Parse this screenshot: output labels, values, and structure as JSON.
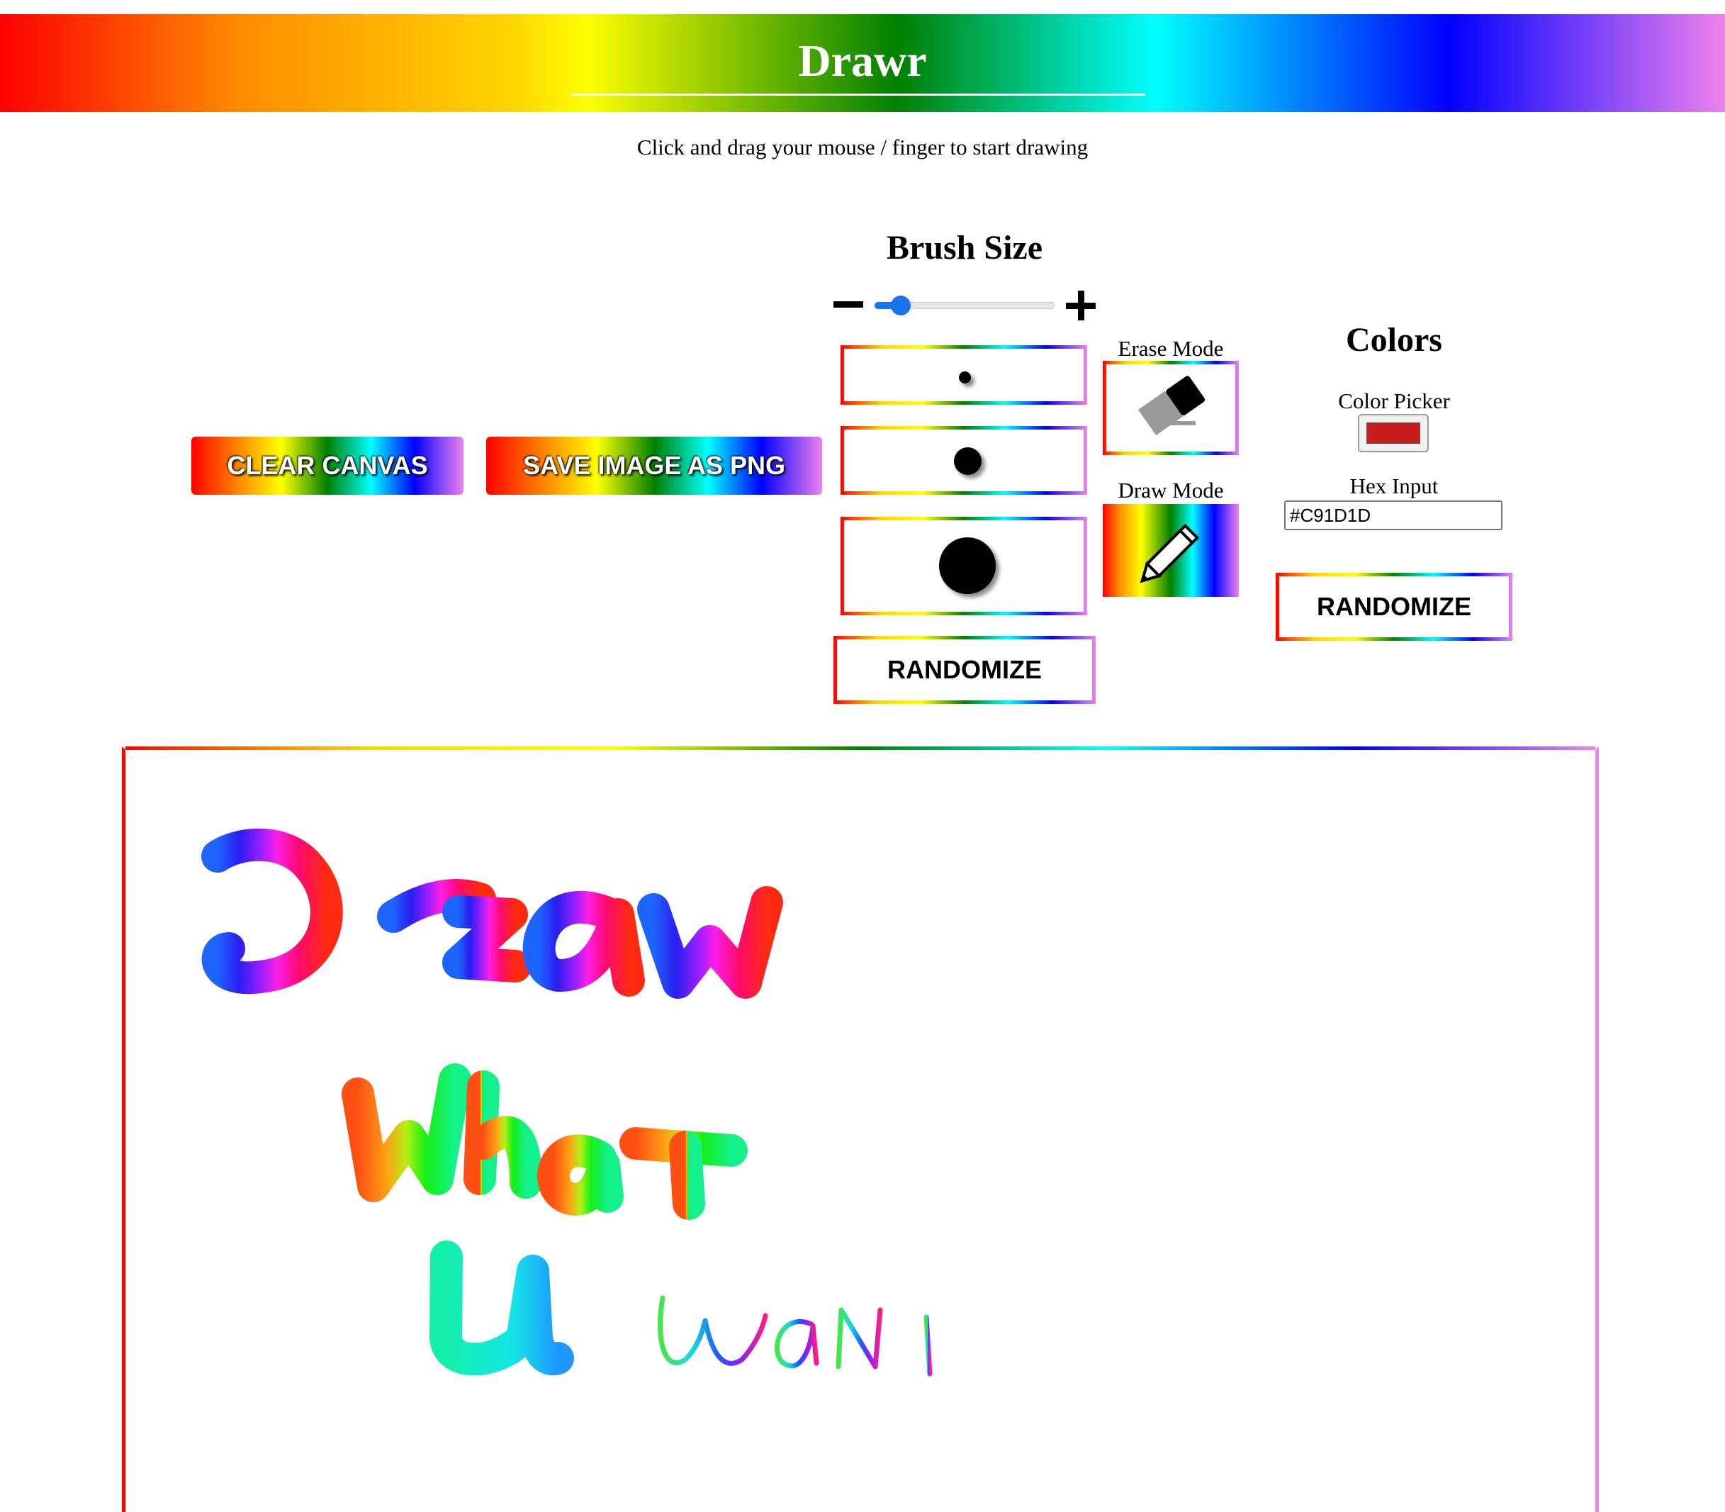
{
  "header": {
    "title": "Drawr"
  },
  "subtitle": "Click and drag your mouse / finger to start drawing",
  "actions": {
    "clear_label": "CLEAR CANVAS",
    "save_label": "SAVE IMAGE AS PNG"
  },
  "brush": {
    "heading": "Brush Size",
    "slider_value_fraction": 0.1,
    "presets": [
      "small-brush",
      "medium-brush",
      "large-brush"
    ],
    "randomize_label": "RANDOMIZE"
  },
  "modes": {
    "erase_label": "Erase Mode",
    "draw_label": "Draw Mode",
    "erase_icon": "eraser-icon",
    "draw_icon": "pencil-icon"
  },
  "colors": {
    "heading": "Colors",
    "picker_label": "Color Picker",
    "picker_value": "#C91D1D",
    "hex_label": "Hex Input",
    "hex_value": "#C91D1D",
    "randomize_label": "RANDOMIZE"
  },
  "canvas": {
    "handwritten_content": [
      "Draw",
      "What",
      "U",
      "WANT"
    ]
  }
}
